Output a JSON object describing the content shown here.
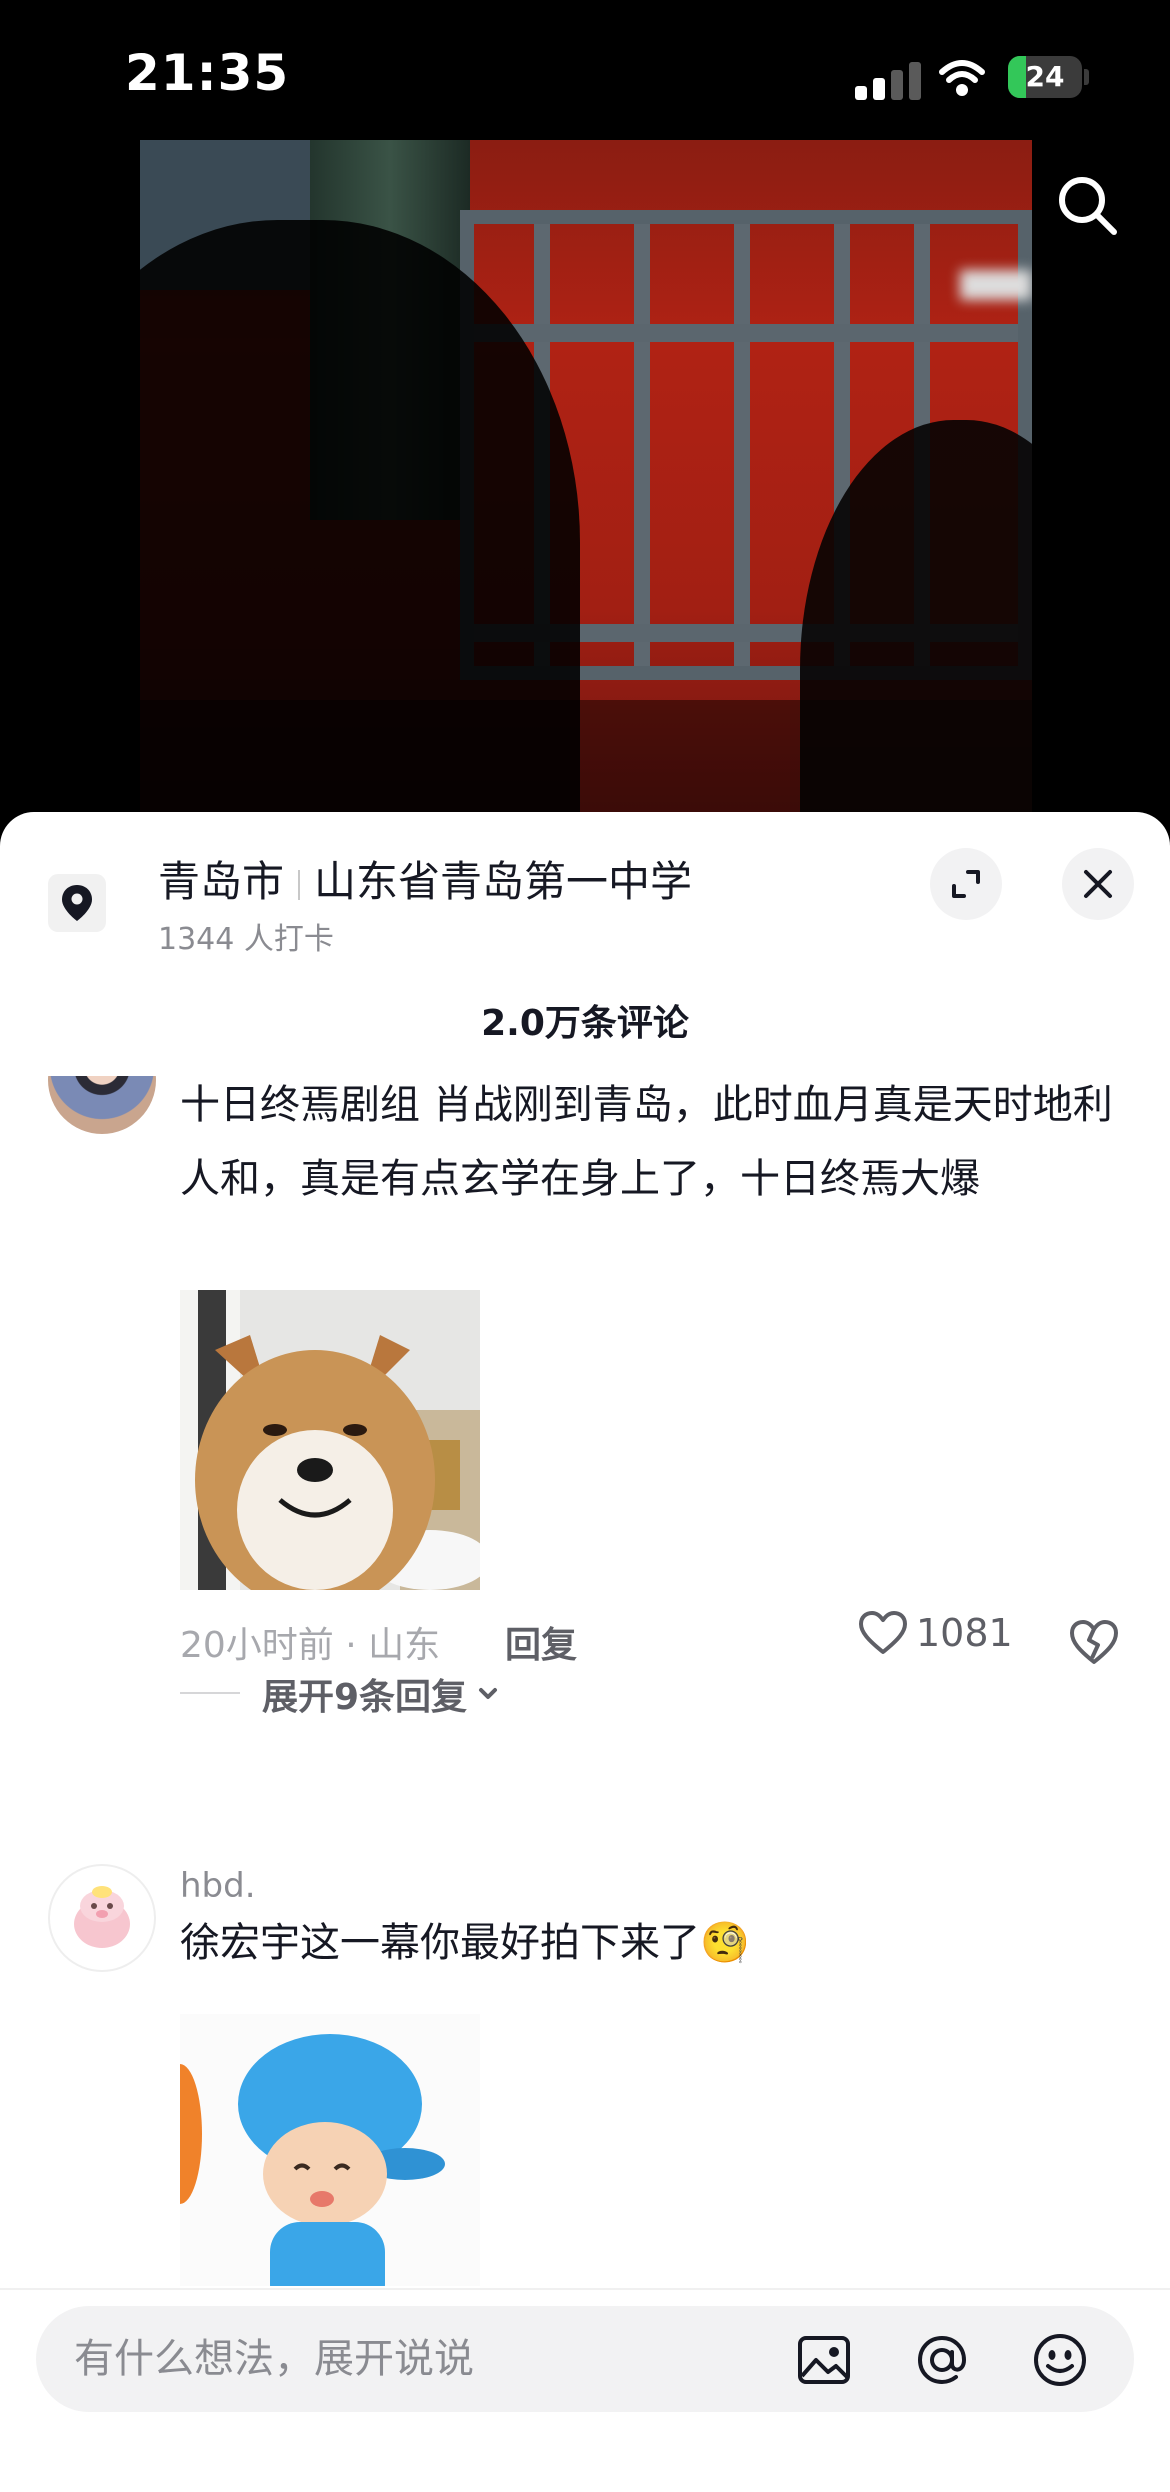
{
  "status_bar": {
    "time": "21:35",
    "battery": "24",
    "battery_level": 0.24
  },
  "location": {
    "city": "青岛市",
    "place": "山东省青岛第一中学",
    "checkins": "1344 人打卡"
  },
  "comments_header": {
    "count_label": "2.0万条评论"
  },
  "comments": [
    {
      "username": "",
      "text": "十日终焉剧组 肖战刚到青岛，此时血月真是天时地利人和，真是有点玄学在身上了，十日终焉大爆",
      "meta": "20小时前 · 山东",
      "reply_label": "回复",
      "likes": "1081",
      "expand_label": "展开9条回复"
    },
    {
      "username": "hbd.",
      "text": "徐宏宇这一幕你最好拍下来了🧐"
    }
  ],
  "input": {
    "placeholder": "有什么想法，展开说说"
  },
  "icons": {
    "search": "search-icon",
    "location": "location-pin-icon",
    "expand": "expand-icon",
    "close": "close-icon",
    "image": "image-icon",
    "mention": "at-icon",
    "emoji": "emoji-icon"
  },
  "colors": {
    "text_primary": "#161823",
    "text_secondary": "#8a8b91",
    "battery_green": "#33c759"
  }
}
